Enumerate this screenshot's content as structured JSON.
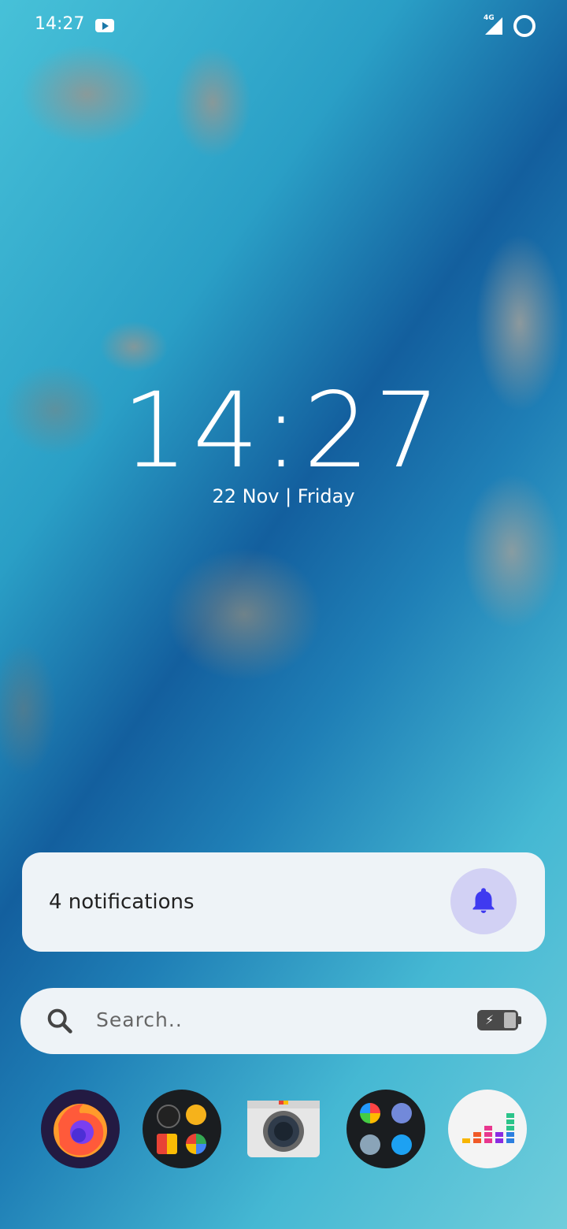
{
  "status_bar": {
    "time": "14:27",
    "network": "4G"
  },
  "lock": {
    "time": "14:27",
    "date": "22 Nov | Friday"
  },
  "notifications": {
    "label": "4 notifications"
  },
  "search": {
    "placeholder": "Search.."
  },
  "dock": {
    "apps": [
      {
        "icon": "firefox-icon"
      },
      {
        "icon": "google-apps-folder-icon"
      },
      {
        "icon": "camera-icon"
      },
      {
        "icon": "social-apps-folder-icon"
      },
      {
        "icon": "deezer-icon"
      }
    ]
  },
  "colors": {
    "accent_bell": "#3f3af0",
    "card_bg": "#eef3f7"
  }
}
